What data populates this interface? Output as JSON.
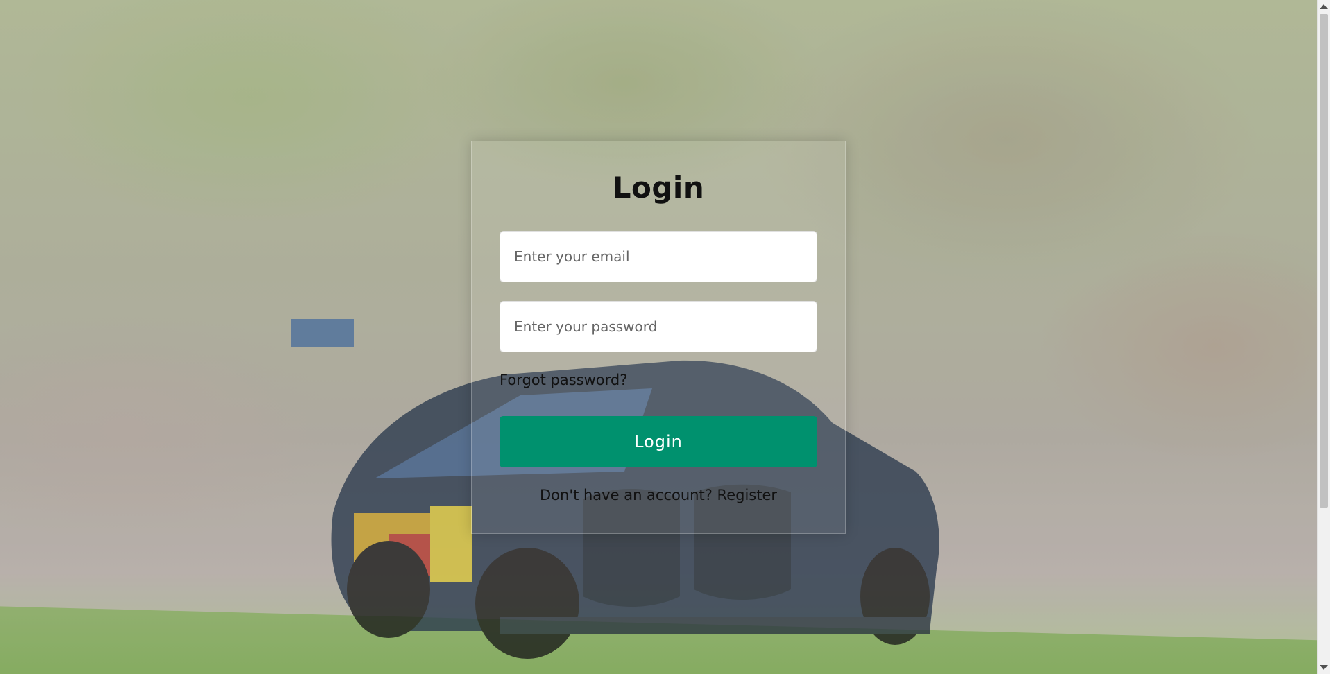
{
  "login": {
    "title": "Login",
    "email_placeholder": "Enter your email",
    "password_placeholder": "Enter your password",
    "forgot_password": "Forgot password?",
    "login_button": "Login",
    "no_account_text": "Don't have an account?",
    "register_link": "Register"
  },
  "colors": {
    "primary_button": "#00916e"
  }
}
